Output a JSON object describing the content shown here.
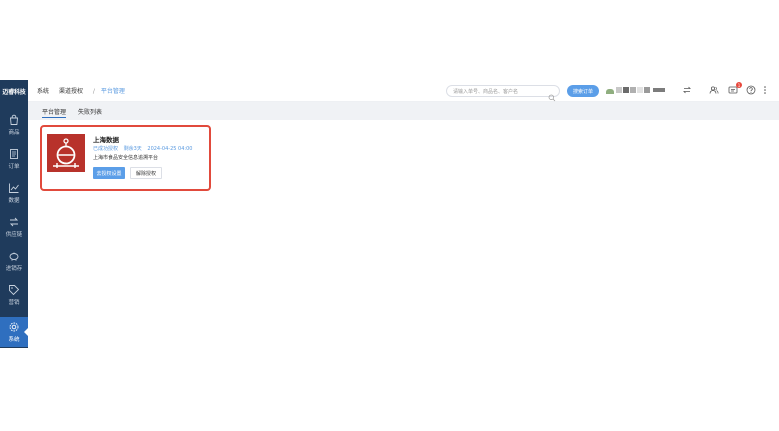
{
  "app": {
    "logo_text": "迈睿科技"
  },
  "sidebar": {
    "items": [
      {
        "label": "商品",
        "icon": "bag-icon"
      },
      {
        "label": "订单",
        "icon": "document-icon"
      },
      {
        "label": "数据",
        "icon": "line-chart-icon"
      },
      {
        "label": "供应链",
        "icon": "exchange-icon"
      },
      {
        "label": "进销存",
        "icon": "piggy-bank-icon"
      },
      {
        "label": "营销",
        "icon": "tag-icon"
      },
      {
        "label": "系统",
        "icon": "gear-icon",
        "active": true
      }
    ]
  },
  "topbar": {
    "breadcrumb": [
      "系统",
      "渠道授权",
      "平台管理"
    ],
    "search_placeholder": "请输入单号、商品名、客户名",
    "search_button": "搜索订单",
    "badge_count": "1"
  },
  "tabs": [
    {
      "label": "平台管理",
      "active": true
    },
    {
      "label": "失败列表",
      "active": false
    }
  ],
  "card": {
    "title": "上海数据",
    "status": "已成功授权",
    "days_left": "剩余3天",
    "date": "2024-04-25 04:00",
    "description": "上海市食品安全信息追溯平台",
    "primary_button": "去授权设置",
    "secondary_button": "解除授权"
  },
  "colors": {
    "sidebar_bg": "#1f3b5c",
    "sidebar_active": "#2f6fbf",
    "accent": "#5b9ee8",
    "card_border": "#e14a3c",
    "logo_bg": "#b8322b"
  }
}
